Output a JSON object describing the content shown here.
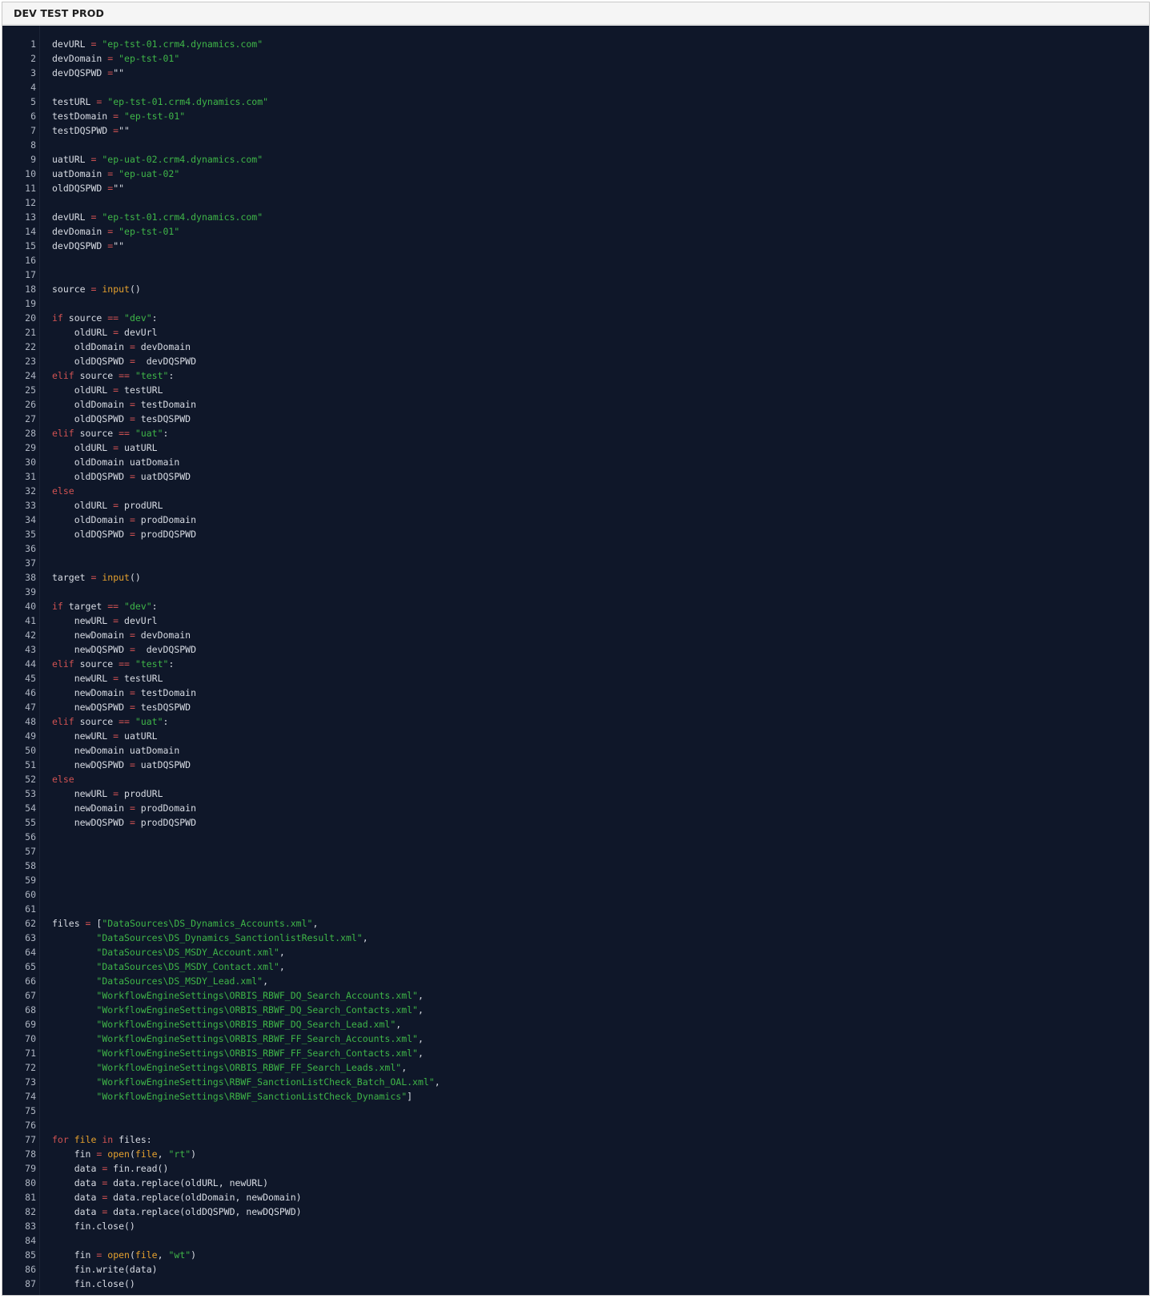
{
  "panel": {
    "title": "DEV TEST PROD"
  },
  "colors": {
    "editor_background": "#0f1729",
    "keyword": "#d05252",
    "string": "#3fb648",
    "builtin_function": "#e5a12e",
    "text": "#d8dce4",
    "line_number": "#aeb5c2"
  },
  "code_lines": [
    [
      [
        "t",
        "devURL "
      ],
      [
        "o",
        "="
      ],
      [
        "t",
        " "
      ],
      [
        "s",
        "\"ep-tst-01.crm4.dynamics.com\""
      ]
    ],
    [
      [
        "t",
        "devDomain "
      ],
      [
        "o",
        "="
      ],
      [
        "t",
        " "
      ],
      [
        "s",
        "\"ep-tst-01\""
      ]
    ],
    [
      [
        "t",
        "devDQSPWD "
      ],
      [
        "o",
        "="
      ],
      [
        "t",
        "\"\""
      ]
    ],
    [],
    [
      [
        "t",
        "testURL "
      ],
      [
        "o",
        "="
      ],
      [
        "t",
        " "
      ],
      [
        "s",
        "\"ep-tst-01.crm4.dynamics.com\""
      ]
    ],
    [
      [
        "t",
        "testDomain "
      ],
      [
        "o",
        "="
      ],
      [
        "t",
        " "
      ],
      [
        "s",
        "\"ep-tst-01\""
      ]
    ],
    [
      [
        "t",
        "testDQSPWD "
      ],
      [
        "o",
        "="
      ],
      [
        "t",
        "\"\""
      ]
    ],
    [],
    [
      [
        "t",
        "uatURL "
      ],
      [
        "o",
        "="
      ],
      [
        "t",
        " "
      ],
      [
        "s",
        "\"ep-uat-02.crm4.dynamics.com\""
      ]
    ],
    [
      [
        "t",
        "uatDomain "
      ],
      [
        "o",
        "="
      ],
      [
        "t",
        " "
      ],
      [
        "s",
        "\"ep-uat-02\""
      ]
    ],
    [
      [
        "t",
        "oldDQSPWD "
      ],
      [
        "o",
        "="
      ],
      [
        "t",
        "\"\""
      ]
    ],
    [],
    [
      [
        "t",
        "devURL "
      ],
      [
        "o",
        "="
      ],
      [
        "t",
        " "
      ],
      [
        "s",
        "\"ep-tst-01.crm4.dynamics.com\""
      ]
    ],
    [
      [
        "t",
        "devDomain "
      ],
      [
        "o",
        "="
      ],
      [
        "t",
        " "
      ],
      [
        "s",
        "\"ep-tst-01\""
      ]
    ],
    [
      [
        "t",
        "devDQSPWD "
      ],
      [
        "o",
        "="
      ],
      [
        "t",
        "\"\""
      ]
    ],
    [],
    [],
    [
      [
        "t",
        "source "
      ],
      [
        "o",
        "="
      ],
      [
        "t",
        " "
      ],
      [
        "f",
        "input"
      ],
      [
        "t",
        "()"
      ]
    ],
    [],
    [
      [
        "k",
        "if"
      ],
      [
        "t",
        " source "
      ],
      [
        "o",
        "=="
      ],
      [
        "t",
        " "
      ],
      [
        "s",
        "\"dev\""
      ],
      [
        "t",
        ":"
      ]
    ],
    [
      [
        "t",
        "    oldURL "
      ],
      [
        "o",
        "="
      ],
      [
        "t",
        " devUrl"
      ]
    ],
    [
      [
        "t",
        "    oldDomain "
      ],
      [
        "o",
        "="
      ],
      [
        "t",
        " devDomain"
      ]
    ],
    [
      [
        "t",
        "    oldDQSPWD "
      ],
      [
        "o",
        "="
      ],
      [
        "t",
        "  devDQSPWD"
      ]
    ],
    [
      [
        "k",
        "elif"
      ],
      [
        "t",
        " source "
      ],
      [
        "o",
        "=="
      ],
      [
        "t",
        " "
      ],
      [
        "s",
        "\"test\""
      ],
      [
        "t",
        ":"
      ]
    ],
    [
      [
        "t",
        "    oldURL "
      ],
      [
        "o",
        "="
      ],
      [
        "t",
        " testURL"
      ]
    ],
    [
      [
        "t",
        "    oldDomain "
      ],
      [
        "o",
        "="
      ],
      [
        "t",
        " testDomain"
      ]
    ],
    [
      [
        "t",
        "    oldDQSPWD "
      ],
      [
        "o",
        "="
      ],
      [
        "t",
        " tesDQSPWD"
      ]
    ],
    [
      [
        "k",
        "elif"
      ],
      [
        "t",
        " source "
      ],
      [
        "o",
        "=="
      ],
      [
        "t",
        " "
      ],
      [
        "s",
        "\"uat\""
      ],
      [
        "t",
        ":"
      ]
    ],
    [
      [
        "t",
        "    oldURL "
      ],
      [
        "o",
        "="
      ],
      [
        "t",
        " uatURL"
      ]
    ],
    [
      [
        "t",
        "    oldDomain uatDomain"
      ]
    ],
    [
      [
        "t",
        "    oldDQSPWD "
      ],
      [
        "o",
        "="
      ],
      [
        "t",
        " uatDQSPWD"
      ]
    ],
    [
      [
        "k",
        "else"
      ]
    ],
    [
      [
        "t",
        "    oldURL "
      ],
      [
        "o",
        "="
      ],
      [
        "t",
        " prodURL"
      ]
    ],
    [
      [
        "t",
        "    oldDomain "
      ],
      [
        "o",
        "="
      ],
      [
        "t",
        " prodDomain"
      ]
    ],
    [
      [
        "t",
        "    oldDQSPWD "
      ],
      [
        "o",
        "="
      ],
      [
        "t",
        " prodDQSPWD"
      ]
    ],
    [],
    [],
    [
      [
        "t",
        "target "
      ],
      [
        "o",
        "="
      ],
      [
        "t",
        " "
      ],
      [
        "f",
        "input"
      ],
      [
        "t",
        "()"
      ]
    ],
    [],
    [
      [
        "k",
        "if"
      ],
      [
        "t",
        " target "
      ],
      [
        "o",
        "=="
      ],
      [
        "t",
        " "
      ],
      [
        "s",
        "\"dev\""
      ],
      [
        "t",
        ":"
      ]
    ],
    [
      [
        "t",
        "    newURL "
      ],
      [
        "o",
        "="
      ],
      [
        "t",
        " devUrl"
      ]
    ],
    [
      [
        "t",
        "    newDomain "
      ],
      [
        "o",
        "="
      ],
      [
        "t",
        " devDomain"
      ]
    ],
    [
      [
        "t",
        "    newDQSPWD "
      ],
      [
        "o",
        "="
      ],
      [
        "t",
        "  devDQSPWD"
      ]
    ],
    [
      [
        "k",
        "elif"
      ],
      [
        "t",
        " source "
      ],
      [
        "o",
        "=="
      ],
      [
        "t",
        " "
      ],
      [
        "s",
        "\"test\""
      ],
      [
        "t",
        ":"
      ]
    ],
    [
      [
        "t",
        "    newURL "
      ],
      [
        "o",
        "="
      ],
      [
        "t",
        " testURL"
      ]
    ],
    [
      [
        "t",
        "    newDomain "
      ],
      [
        "o",
        "="
      ],
      [
        "t",
        " testDomain"
      ]
    ],
    [
      [
        "t",
        "    newDQSPWD "
      ],
      [
        "o",
        "="
      ],
      [
        "t",
        " tesDQSPWD"
      ]
    ],
    [
      [
        "k",
        "elif"
      ],
      [
        "t",
        " source "
      ],
      [
        "o",
        "=="
      ],
      [
        "t",
        " "
      ],
      [
        "s",
        "\"uat\""
      ],
      [
        "t",
        ":"
      ]
    ],
    [
      [
        "t",
        "    newURL "
      ],
      [
        "o",
        "="
      ],
      [
        "t",
        " uatURL"
      ]
    ],
    [
      [
        "t",
        "    newDomain uatDomain"
      ]
    ],
    [
      [
        "t",
        "    newDQSPWD "
      ],
      [
        "o",
        "="
      ],
      [
        "t",
        " uatDQSPWD"
      ]
    ],
    [
      [
        "k",
        "else"
      ]
    ],
    [
      [
        "t",
        "    newURL "
      ],
      [
        "o",
        "="
      ],
      [
        "t",
        " prodURL"
      ]
    ],
    [
      [
        "t",
        "    newDomain "
      ],
      [
        "o",
        "="
      ],
      [
        "t",
        " prodDomain"
      ]
    ],
    [
      [
        "t",
        "    newDQSPWD "
      ],
      [
        "o",
        "="
      ],
      [
        "t",
        " prodDQSPWD"
      ]
    ],
    [],
    [],
    [],
    [],
    [],
    [],
    [
      [
        "t",
        "files "
      ],
      [
        "o",
        "="
      ],
      [
        "t",
        " ["
      ],
      [
        "s",
        "\"DataSources\\DS_Dynamics_Accounts.xml\""
      ],
      [
        "t",
        ","
      ]
    ],
    [
      [
        "t",
        "        "
      ],
      [
        "s",
        "\"DataSources\\DS_Dynamics_SanctionlistResult.xml\""
      ],
      [
        "t",
        ","
      ]
    ],
    [
      [
        "t",
        "        "
      ],
      [
        "s",
        "\"DataSources\\DS_MSDY_Account.xml\""
      ],
      [
        "t",
        ","
      ]
    ],
    [
      [
        "t",
        "        "
      ],
      [
        "s",
        "\"DataSources\\DS_MSDY_Contact.xml\""
      ],
      [
        "t",
        ","
      ]
    ],
    [
      [
        "t",
        "        "
      ],
      [
        "s",
        "\"DataSources\\DS_MSDY_Lead.xml\""
      ],
      [
        "t",
        ","
      ]
    ],
    [
      [
        "t",
        "        "
      ],
      [
        "s",
        "\"WorkflowEngineSettings\\ORBIS_RBWF_DQ_Search_Accounts.xml\""
      ],
      [
        "t",
        ","
      ]
    ],
    [
      [
        "t",
        "        "
      ],
      [
        "s",
        "\"WorkflowEngineSettings\\ORBIS_RBWF_DQ_Search_Contacts.xml\""
      ],
      [
        "t",
        ","
      ]
    ],
    [
      [
        "t",
        "        "
      ],
      [
        "s",
        "\"WorkflowEngineSettings\\ORBIS_RBWF_DQ_Search_Lead.xml\""
      ],
      [
        "t",
        ","
      ]
    ],
    [
      [
        "t",
        "        "
      ],
      [
        "s",
        "\"WorkflowEngineSettings\\ORBIS_RBWF_FF_Search_Accounts.xml\""
      ],
      [
        "t",
        ","
      ]
    ],
    [
      [
        "t",
        "        "
      ],
      [
        "s",
        "\"WorkflowEngineSettings\\ORBIS_RBWF_FF_Search_Contacts.xml\""
      ],
      [
        "t",
        ","
      ]
    ],
    [
      [
        "t",
        "        "
      ],
      [
        "s",
        "\"WorkflowEngineSettings\\ORBIS_RBWF_FF_Search_Leads.xml\""
      ],
      [
        "t",
        ","
      ]
    ],
    [
      [
        "t",
        "        "
      ],
      [
        "s",
        "\"WorkflowEngineSettings\\RBWF_SanctionListCheck_Batch_OAL.xml\""
      ],
      [
        "t",
        ","
      ]
    ],
    [
      [
        "t",
        "        "
      ],
      [
        "s",
        "\"WorkflowEngineSettings\\RBWF_SanctionListCheck_Dynamics\""
      ],
      [
        "t",
        "]"
      ]
    ],
    [],
    [],
    [
      [
        "k",
        "for"
      ],
      [
        "t",
        " "
      ],
      [
        "f",
        "file"
      ],
      [
        "t",
        " "
      ],
      [
        "k",
        "in"
      ],
      [
        "t",
        " files:"
      ]
    ],
    [
      [
        "t",
        "    fin "
      ],
      [
        "o",
        "="
      ],
      [
        "t",
        " "
      ],
      [
        "f",
        "open"
      ],
      [
        "t",
        "("
      ],
      [
        "f",
        "file"
      ],
      [
        "t",
        ", "
      ],
      [
        "s",
        "\"rt\""
      ],
      [
        "t",
        ")"
      ]
    ],
    [
      [
        "t",
        "    data "
      ],
      [
        "o",
        "="
      ],
      [
        "t",
        " fin.read()"
      ]
    ],
    [
      [
        "t",
        "    data "
      ],
      [
        "o",
        "="
      ],
      [
        "t",
        " data.replace(oldURL, newURL)"
      ]
    ],
    [
      [
        "t",
        "    data "
      ],
      [
        "o",
        "="
      ],
      [
        "t",
        " data.replace(oldDomain, newDomain)"
      ]
    ],
    [
      [
        "t",
        "    data "
      ],
      [
        "o",
        "="
      ],
      [
        "t",
        " data.replace(oldDQSPWD, newDQSPWD)"
      ]
    ],
    [
      [
        "t",
        "    fin.close()"
      ]
    ],
    [],
    [
      [
        "t",
        "    fin "
      ],
      [
        "o",
        "="
      ],
      [
        "t",
        " "
      ],
      [
        "f",
        "open"
      ],
      [
        "t",
        "("
      ],
      [
        "f",
        "file"
      ],
      [
        "t",
        ", "
      ],
      [
        "s",
        "\"wt\""
      ],
      [
        "t",
        ")"
      ]
    ],
    [
      [
        "t",
        "    fin.write(data)"
      ]
    ],
    [
      [
        "t",
        "    fin.close()"
      ]
    ]
  ]
}
